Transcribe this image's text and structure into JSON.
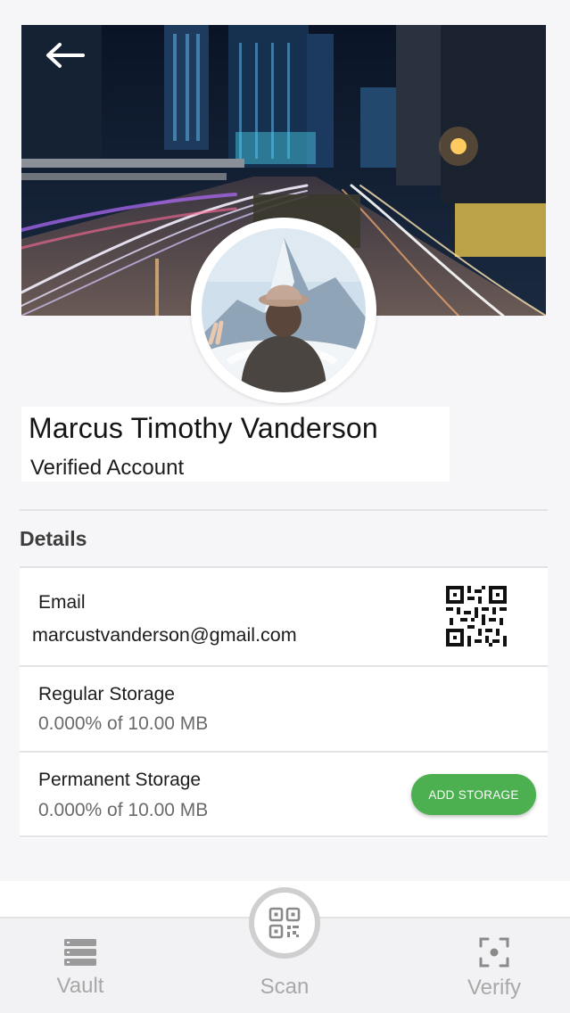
{
  "profile": {
    "name": "Marcus Timothy Vanderson",
    "status": "Verified Account"
  },
  "details": {
    "title": "Details",
    "email_label": "Email",
    "email_value": "marcustvanderson@gmail.com",
    "regular_storage_label": "Regular Storage",
    "regular_storage_value": "0.000% of 10.00 MB",
    "permanent_storage_label": "Permanent Storage",
    "permanent_storage_value": "0.000% of 10.00 MB",
    "add_storage_label": "ADD STORAGE"
  },
  "nav": {
    "vault": "Vault",
    "scan": "Scan",
    "verify": "Verify"
  },
  "colors": {
    "accent_green": "#4caf50",
    "nav_inactive": "#a8a8a8"
  },
  "icons": {
    "back": "arrow-left-icon",
    "qr": "qr-code-icon",
    "vault": "stack-icon",
    "scan": "qr-scan-icon",
    "verify": "focus-frame-icon"
  }
}
